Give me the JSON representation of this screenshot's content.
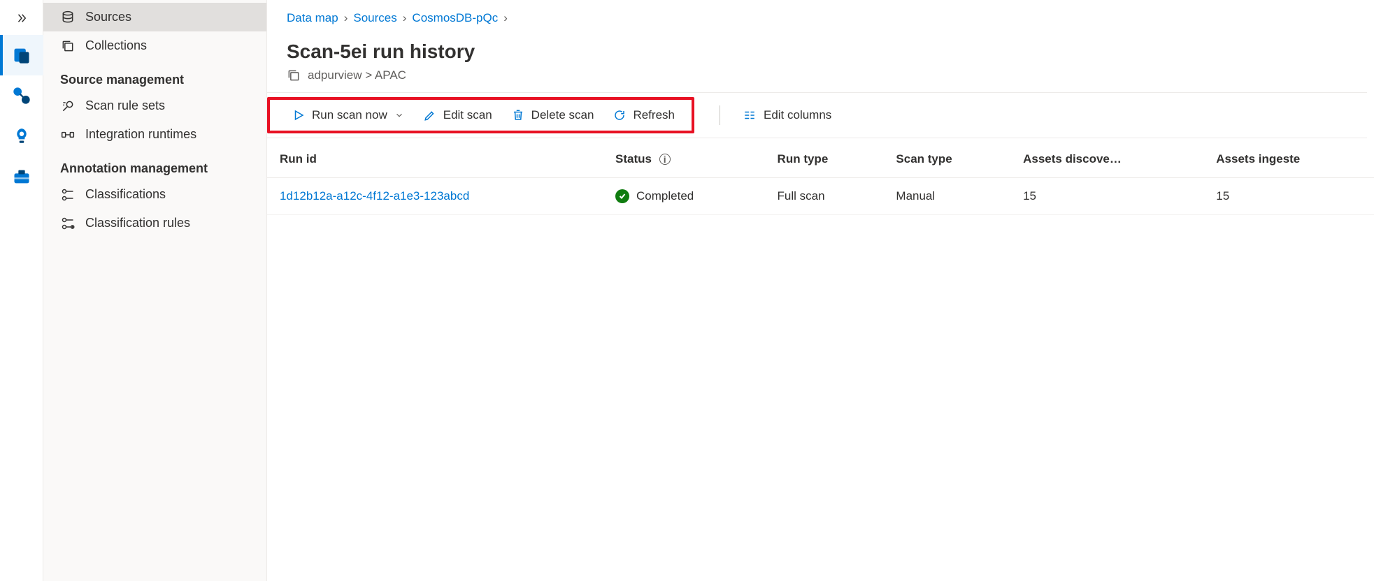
{
  "rail": {
    "expand_tooltip": "Expand"
  },
  "sidebar": {
    "items": [
      {
        "label": "Sources"
      },
      {
        "label": "Collections"
      }
    ],
    "sections": [
      {
        "heading": "Source management",
        "items": [
          {
            "label": "Scan rule sets"
          },
          {
            "label": "Integration runtimes"
          }
        ]
      },
      {
        "heading": "Annotation management",
        "items": [
          {
            "label": "Classifications"
          },
          {
            "label": "Classification rules"
          }
        ]
      }
    ]
  },
  "breadcrumb": [
    {
      "label": "Data map"
    },
    {
      "label": "Sources"
    },
    {
      "label": "CosmosDB-pQc"
    }
  ],
  "page": {
    "title": "Scan-5ei run history",
    "collection_path": "adpurview > APAC"
  },
  "toolbar": {
    "run_scan": "Run scan now",
    "edit_scan": "Edit scan",
    "delete_scan": "Delete scan",
    "refresh": "Refresh",
    "edit_columns": "Edit columns"
  },
  "table": {
    "headers": {
      "run_id": "Run id",
      "status": "Status",
      "run_type": "Run type",
      "scan_type": "Scan type",
      "assets_discovered": "Assets discove…",
      "assets_ingested": "Assets ingeste"
    },
    "rows": [
      {
        "run_id": "1d12b12a-a12c-4f12-a1e3-123abcd",
        "status": "Completed",
        "run_type": "Full scan",
        "scan_type": "Manual",
        "assets_discovered": "15",
        "assets_ingested": "15"
      }
    ]
  }
}
